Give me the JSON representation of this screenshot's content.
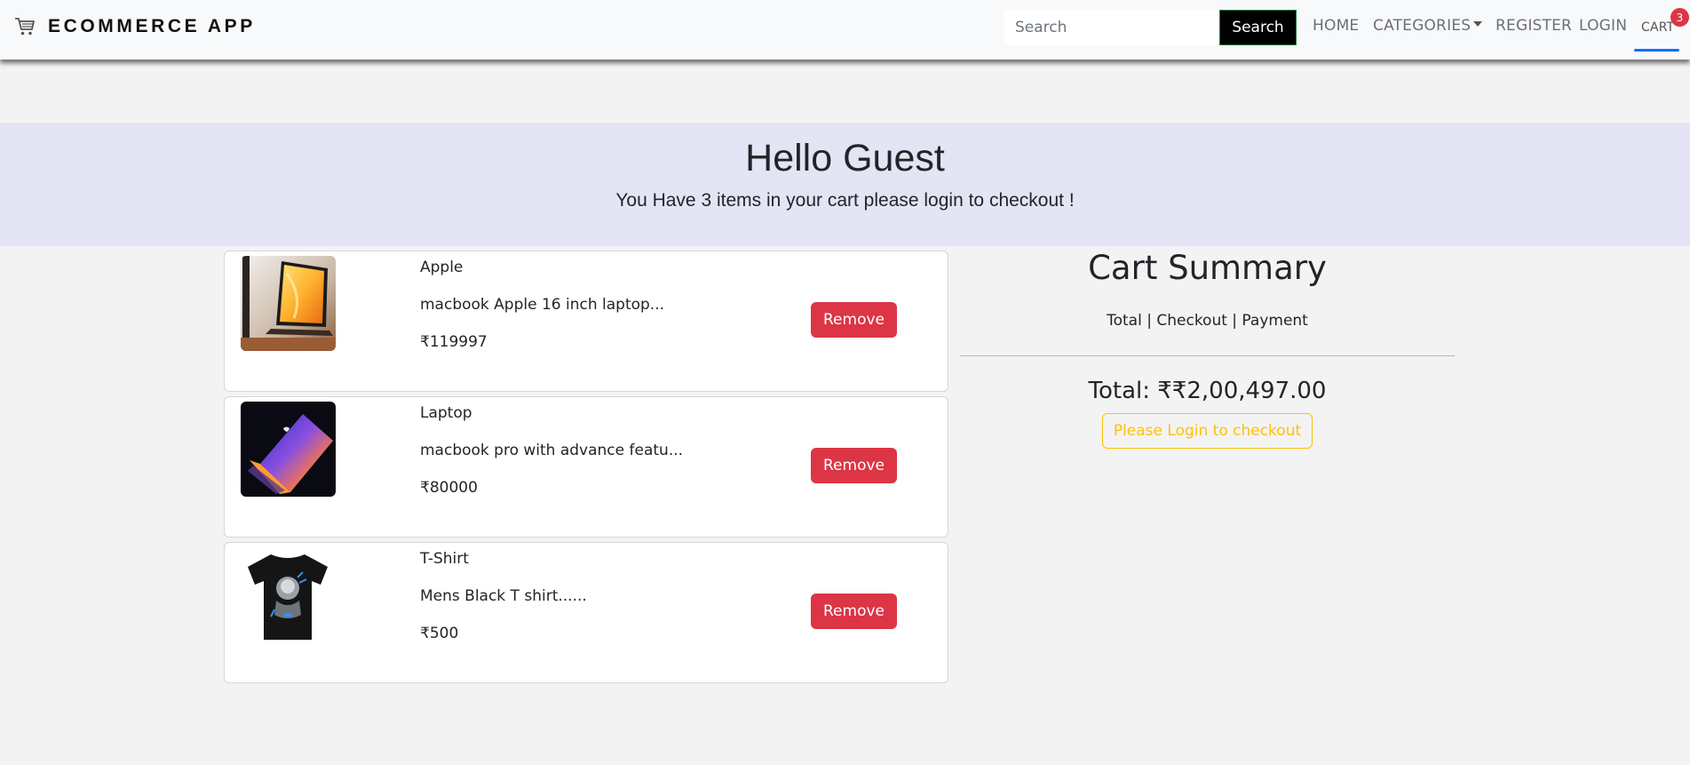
{
  "navbar": {
    "brand": "ECOMMERCE APP",
    "brand_icon": "cart-icon",
    "search_placeholder": "Search",
    "search_button": "Search",
    "links": {
      "home": "HOME",
      "categories": "CATEGORIES",
      "register": "REGISTER",
      "login": "LOGIN",
      "cart": "CART"
    },
    "cart_count": "3"
  },
  "hero": {
    "greeting": "Hello Guest",
    "message": "You Have 3 items in your cart please login to checkout !"
  },
  "cart_items": [
    {
      "name": "Apple",
      "description": "macbook Apple 16 inch laptop...",
      "price": "₹119997",
      "remove_label": "Remove",
      "image": "laptop-image"
    },
    {
      "name": "Laptop",
      "description": "macbook pro with advance featu...",
      "price": "₹80000",
      "remove_label": "Remove",
      "image": "laptop-image"
    },
    {
      "name": "T-Shirt",
      "description": "Mens Black T shirt......",
      "price": "₹500",
      "remove_label": "Remove",
      "image": "tshirt-image"
    }
  ],
  "summary": {
    "title": "Cart Summary",
    "subtitle": "Total | Checkout | Payment",
    "total": "Total: ₹₹2,00,497.00",
    "login_button": "Please Login to checkout"
  },
  "colors": {
    "navbar_bg": "#f8f9fa",
    "hero_bg": "#e5e4f5",
    "danger": "#dc3545",
    "warning": "#ffc107",
    "primary": "#0d6efd"
  }
}
